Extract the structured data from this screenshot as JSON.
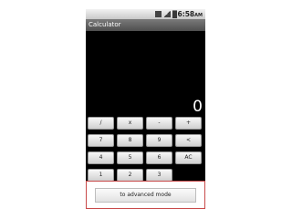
{
  "status_bar": {
    "time": "6:58",
    "ampm": "AM",
    "icons": [
      "usb-icon",
      "signal-icon",
      "battery-icon"
    ]
  },
  "app": {
    "title": "Calculator"
  },
  "display": {
    "value": "0"
  },
  "keypad": {
    "rows": [
      [
        "/",
        "x",
        "-",
        "+"
      ],
      [
        "7",
        "8",
        "9",
        "<"
      ],
      [
        "4",
        "5",
        "6",
        "AC"
      ],
      [
        "1",
        "2",
        "3"
      ]
    ]
  },
  "panel": {
    "advanced_label": "to advanced mode"
  },
  "colors": {
    "screen_bg": "#000000",
    "title_bar": "#5e5e5e",
    "key_face": "#e6e6e6",
    "panel_border": "#c84a4a"
  }
}
